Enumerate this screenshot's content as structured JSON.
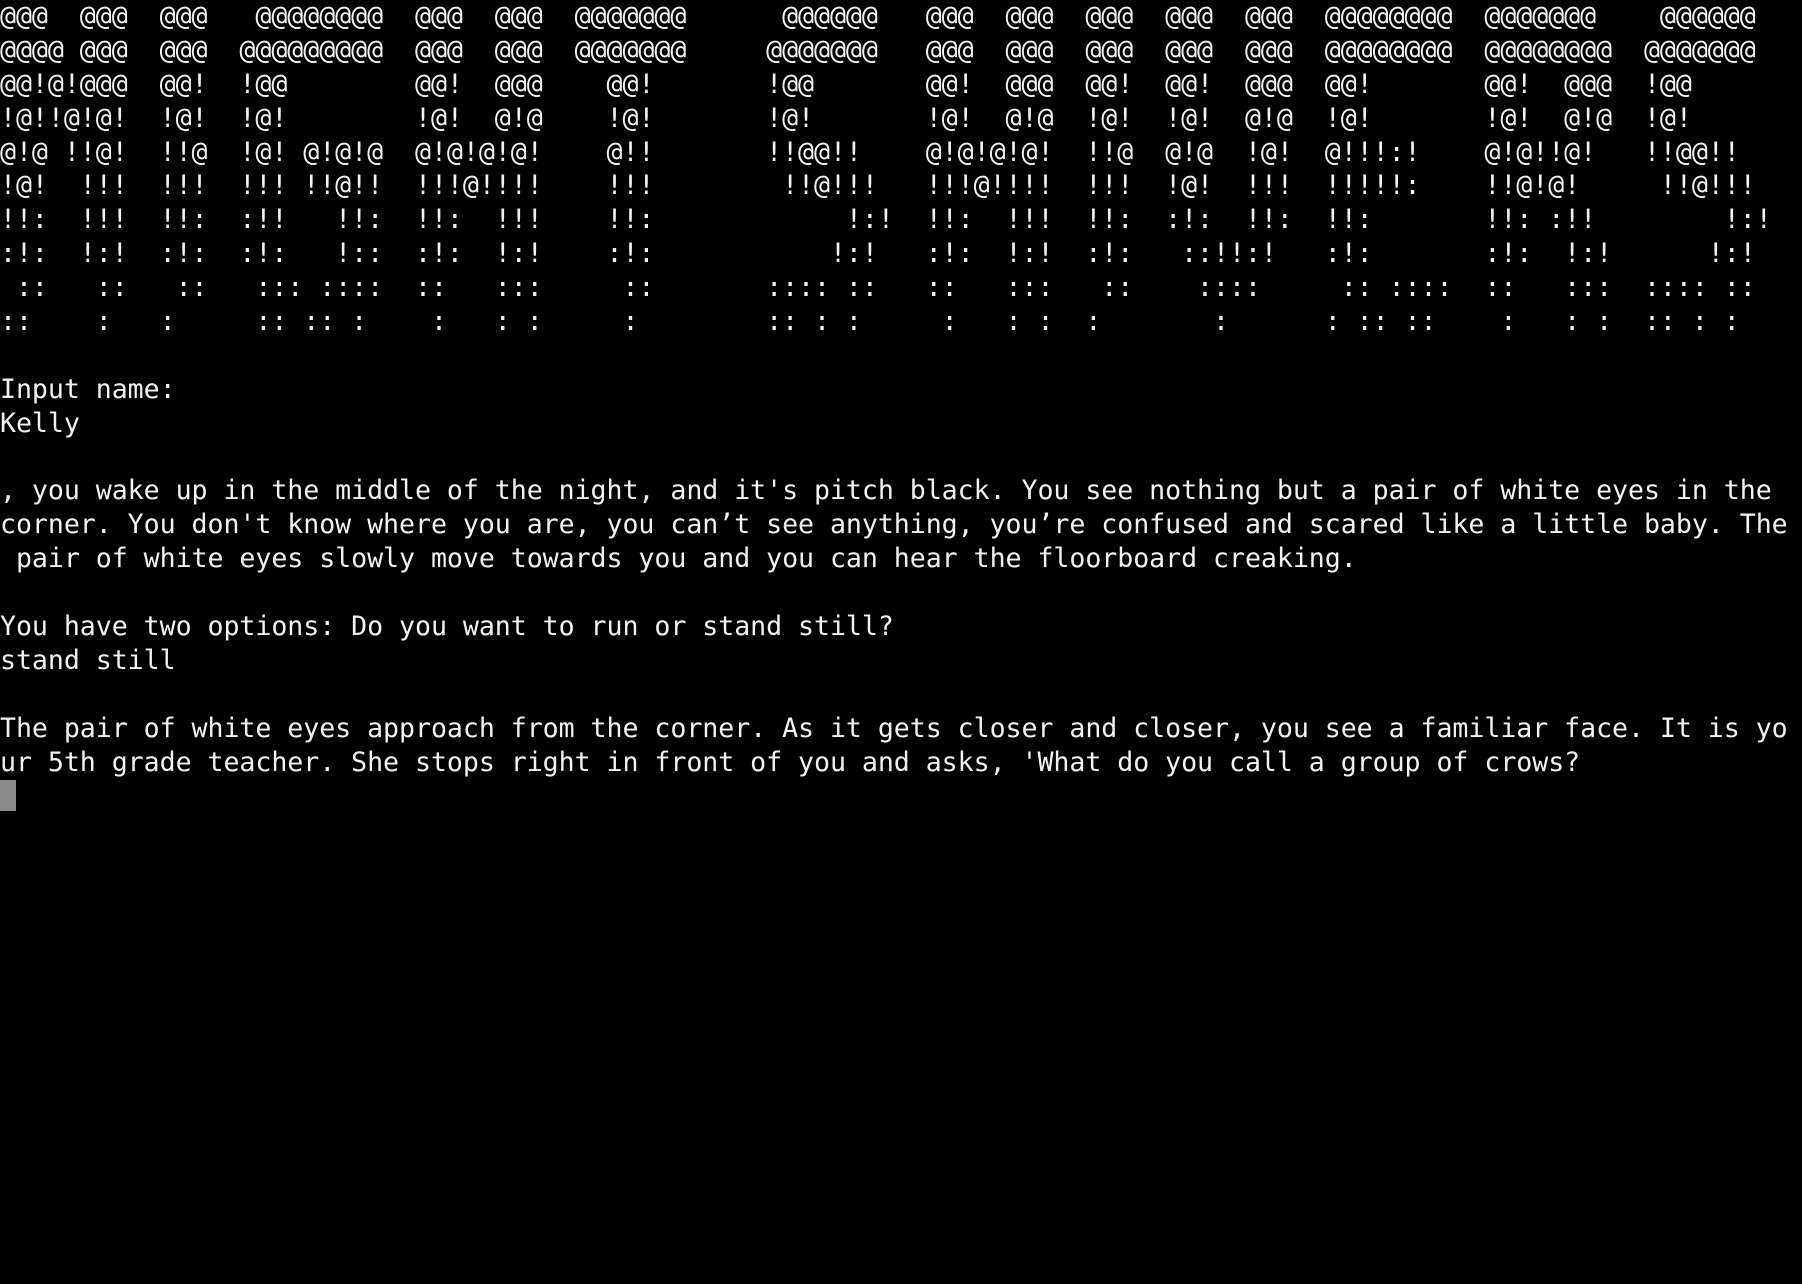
{
  "banner": {
    "art_lines": [
      "@@@  @@@  @@@   @@@@@@@@  @@@  @@@  @@@@@@@      @@@@@@   @@@  @@@  @@@  @@@  @@@  @@@@@@@@  @@@@@@@    @@@@@@",
      "@@@@ @@@  @@@  @@@@@@@@@  @@@  @@@  @@@@@@@     @@@@@@@   @@@  @@@  @@@  @@@  @@@  @@@@@@@@  @@@@@@@@  @@@@@@@",
      "@@!@!@@@  @@!  !@@        @@!  @@@    @@!       !@@       @@!  @@@  @@!  @@!  @@@  @@!       @@!  @@@  !@@",
      "!@!!@!@!  !@!  !@!        !@!  @!@    !@!       !@!       !@!  @!@  !@!  !@!  @!@  !@!       !@!  @!@  !@!",
      "@!@ !!@!  !!@  !@! @!@!@  @!@!@!@!    @!!       !!@@!!    @!@!@!@!  !!@  @!@  !@!  @!!!:!    @!@!!@!   !!@@!!",
      "!@!  !!!  !!!  !!! !!@!!  !!!@!!!!    !!!        !!@!!!   !!!@!!!!  !!!  !@!  !!!  !!!!!:    !!@!@!     !!@!!!",
      "!!:  !!!  !!:  :!!   !!:  !!:  !!!    !!:            !:!  !!:  !!!  !!:  :!:  !!:  !!:       !!: :!!        !:!",
      ":!:  !:!  :!:  :!:   !::  :!:  !:!    :!:           !:!   :!:  !:!  :!:   ::!!:!   :!:       :!:  !:!      !:!",
      " ::   ::   ::   ::: ::::  ::   :::     ::       :::: ::   ::   :::   ::    ::::     :: ::::  ::   :::  :::: ::",
      "::    :   :     :: :: :    :   : :     :        :: : :     :   : :  :       :      : :: ::    :   : :  :: : :"
    ]
  },
  "session": {
    "name_prompt": "Input name:",
    "name_input": "Kelly",
    "intro_lines": [
      ", you wake up in the middle of the night, and it's pitch black. You see nothing but a pair of white eyes in the",
      "corner. You don't know where you are, you can’t see anything, you’re confused and scared like a little baby. The",
      " pair of white eyes slowly move towards you and you can hear the floorboard creaking."
    ],
    "options_prompt": "You have two options: Do you want to run or stand still?",
    "choice_input": "stand still",
    "outcome_lines": [
      "The pair of white eyes approach from the corner. As it gets closer and closer, you see a familiar face. It is yo",
      "ur 5th grade teacher. She stops right in front of you and asks, 'What do you call a group of crows?"
    ]
  },
  "colors": {
    "background": "#000000",
    "text": "#f2f2f2",
    "cursor": "#8a8a8a"
  }
}
